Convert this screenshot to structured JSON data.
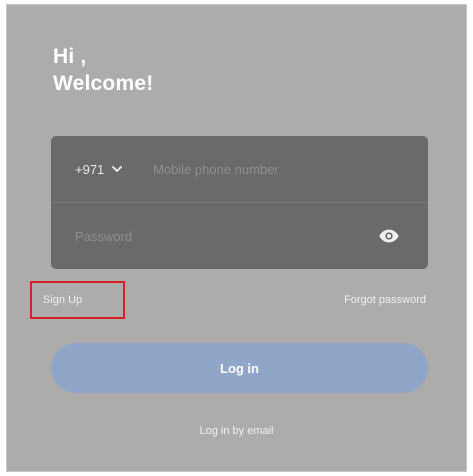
{
  "greeting": {
    "line1": "Hi ,",
    "line2": "Welcome!"
  },
  "form": {
    "country_code": "+971",
    "phone_placeholder": "Mobile phone number",
    "password_placeholder": "Password",
    "chevron_icon": "chevron-down-icon",
    "password_toggle_icon": "eye-icon"
  },
  "links": {
    "sign_up": "Sign Up",
    "forgot_password": "Forgot password",
    "login_by_email": "Log in by email"
  },
  "login_button": {
    "label": "Log in"
  },
  "colors": {
    "background": "#aeacaa",
    "form_card": "#6b6a6a",
    "login_button": "#8fa6c9",
    "highlight": "#d5202a"
  }
}
